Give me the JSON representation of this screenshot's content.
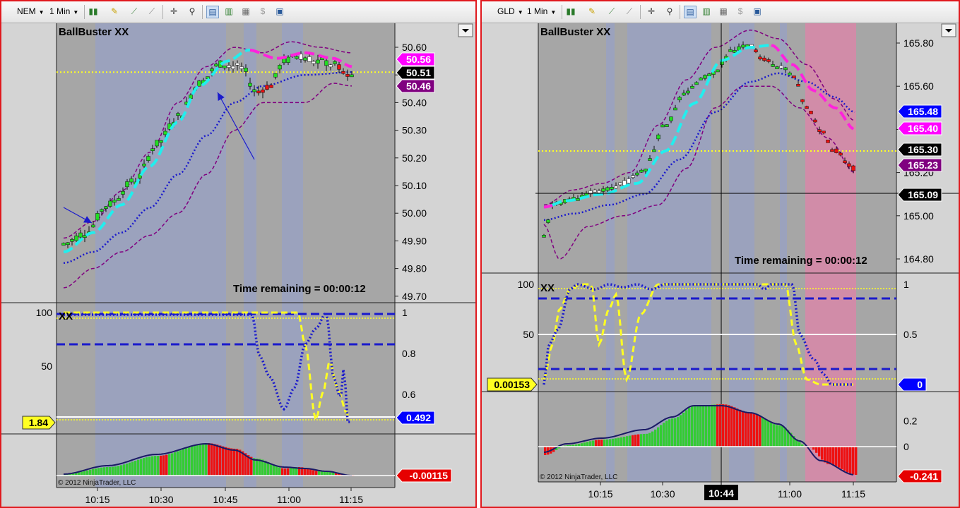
{
  "left": {
    "instrument": "NEM",
    "interval": "1 Min",
    "indicator_title": "BallBuster XX",
    "price_ticks": [
      "50.60",
      "50.50",
      "50.40",
      "50.30",
      "50.20",
      "50.10",
      "50.00",
      "49.90",
      "49.80",
      "49.70"
    ],
    "price_flags": [
      {
        "value": "50.56",
        "color": "#ff00ff"
      },
      {
        "value": "50.51",
        "color": "#000000"
      },
      {
        "value": "50.46",
        "color": "#800080"
      }
    ],
    "time_remaining": "Time remaining = 00:00:12",
    "osc_label": "XX",
    "osc_left_ticks": [
      "100",
      "50"
    ],
    "osc_right_ticks": [
      "1",
      "0.8",
      "0.6"
    ],
    "osc_left_flag": "1.84",
    "osc_right_flag": "0.492",
    "hist_flag": "-0.00115",
    "copyright": "© 2012 NinjaTrader, LLC",
    "time_ticks": [
      "10:15",
      "10:30",
      "10:45",
      "11:00",
      "11:15"
    ]
  },
  "right": {
    "instrument": "GLD",
    "interval": "1 Min",
    "indicator_title": "BallBuster XX",
    "price_ticks": [
      "165.80",
      "165.60",
      "165.40",
      "165.20",
      "165.00",
      "164.80"
    ],
    "price_flags": [
      {
        "value": "165.48",
        "color": "#0000ff"
      },
      {
        "value": "165.40",
        "color": "#ff00ff"
      },
      {
        "value": "165.30",
        "color": "#000000"
      },
      {
        "value": "165.23",
        "color": "#800080"
      },
      {
        "value": "165.09",
        "color": "#000000"
      }
    ],
    "time_remaining": "Time remaining = 00:00:12",
    "osc_label": "XX",
    "osc_left_ticks": [
      "100",
      "50"
    ],
    "osc_right_ticks": [
      "1",
      "0.5"
    ],
    "osc_left_flag": "0.00153",
    "osc_right_flag": "0",
    "hist_ticks": [
      "0.2",
      "0"
    ],
    "hist_flag": "-0.241",
    "copyright": "© 2012 NinjaTrader, LLC",
    "time_ticks": [
      "10:15",
      "10:30",
      "11:00",
      "11:15"
    ],
    "crosshair_time": "10:44"
  },
  "colors": {
    "panel_bg": "#a6a6a6",
    "session_band": "#9aa2c0",
    "pink_band": "#d68aa8",
    "up_bar": "#22dd22",
    "down_bar": "#ee1111",
    "cyan_line": "#22eeee",
    "magenta_line": "#ff22dd",
    "blue_dots": "#1a1acc",
    "envelope": "#800080",
    "yellow": "#ffff22",
    "hist_green": "#33cc33",
    "hist_red": "#ee1111",
    "hist_line": "#1a1a66"
  }
}
